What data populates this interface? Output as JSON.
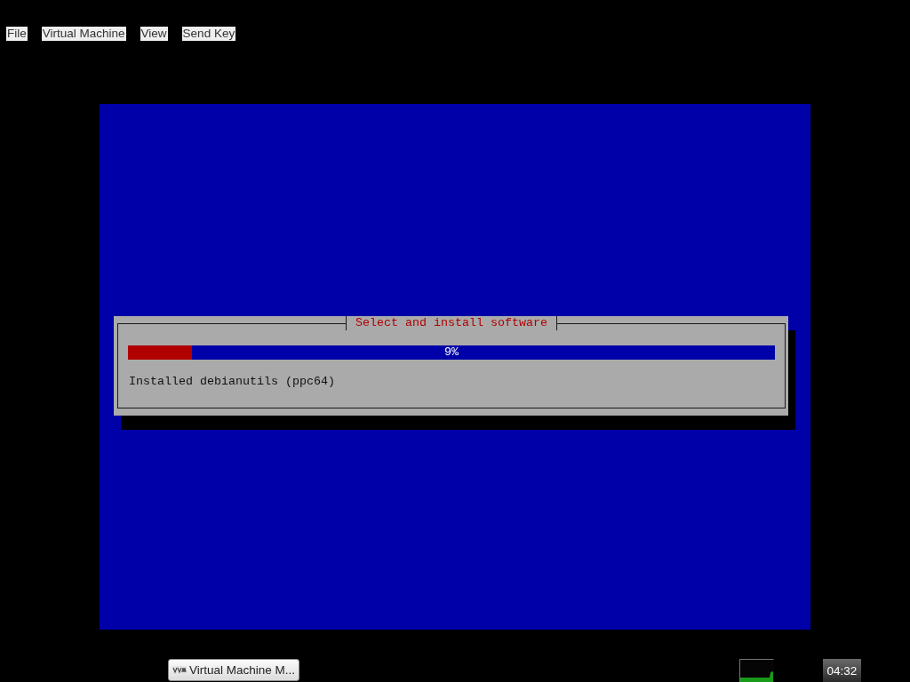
{
  "menu_bar": {
    "items": [
      "File",
      "Virtual Machine",
      "View",
      "Send Key"
    ]
  },
  "vm_screen": {
    "dialog": {
      "title": "Select and install software",
      "progress": {
        "level": 0.099,
        "reading": "9%"
      },
      "status": "Installed debianutils (ppc64)"
    }
  },
  "taskbar": {
    "tasks": [
      {
        "label": "Virtual Machine M..."
      }
    ],
    "clock": "04:32"
  }
}
